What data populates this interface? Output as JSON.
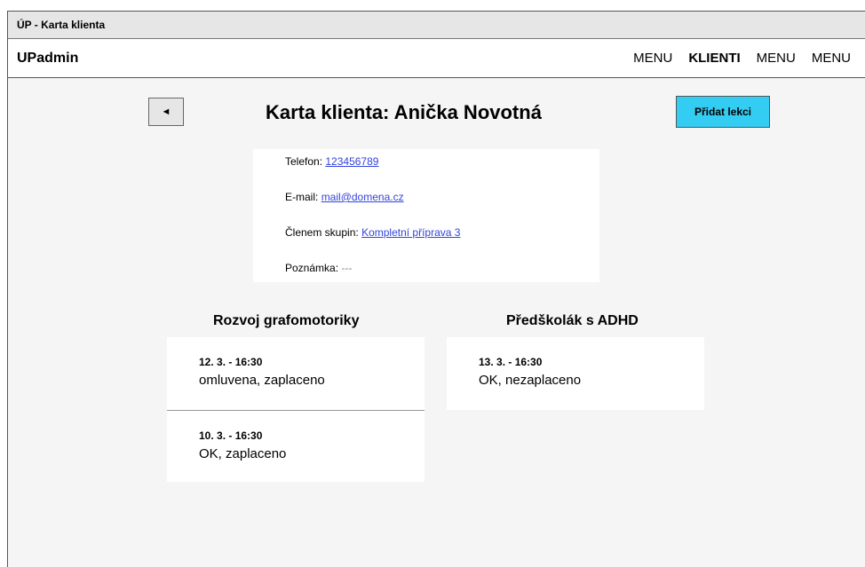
{
  "window": {
    "title": "ÚP - Karta klienta"
  },
  "appbar": {
    "brand": "UPadmin",
    "nav": [
      "MENU",
      "KLIENTI",
      "MENU",
      "MENU"
    ]
  },
  "page": {
    "back_label": "◄",
    "title": "Karta klienta: Anička Novotná",
    "add_lesson_label": "Přidat lekci"
  },
  "client": {
    "phone_label": "Telefon:",
    "phone": "123456789",
    "email_label": "E-mail:",
    "email": "mail@domena.cz",
    "groups_label": "Členem skupin:",
    "groups": "Kompletní příprava 3",
    "note_label": "Poznámka:",
    "note": "---"
  },
  "courses": [
    {
      "title": "Rozvoj grafomotoriky",
      "lessons": [
        {
          "date": "12. 3. - 16:30",
          "status": "omluvena, zaplaceno"
        },
        {
          "date": "10. 3. - 16:30",
          "status": "OK, zaplaceno"
        }
      ]
    },
    {
      "title": "Předškolák s ADHD",
      "lessons": [
        {
          "date": "13. 3. - 16:30",
          "status": "OK, nezaplaceno"
        }
      ]
    }
  ]
}
